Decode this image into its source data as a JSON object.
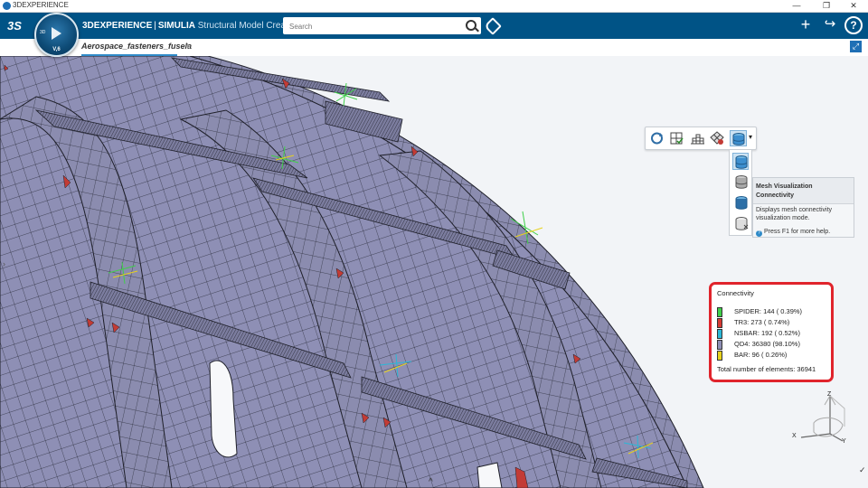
{
  "window": {
    "title": "3DEXPERIENCE",
    "minimize_glyph": "—",
    "restore_glyph": "❐",
    "close_glyph": "✕"
  },
  "topbar": {
    "logo_glyph": "3S",
    "brand_bold": "3DEXPERIENCE",
    "separator": "|",
    "brand_product": "SIMULIA",
    "app_name": "Structural Model Creation",
    "compass_version": "V,6",
    "compass_3d": "3D",
    "search_placeholder": "Search",
    "add_glyph": "+",
    "share_glyph": "↪",
    "help_glyph": "?"
  },
  "tabs": {
    "active_label": "Aerospace_fasteners_fusela",
    "add_glyph": "+",
    "maximize_glyph": "⤢"
  },
  "viewport": {
    "left_arrow_glyph": "›",
    "bottom_arrow_glyph": "^",
    "cursor_glyph": "✓"
  },
  "toolbar": {
    "icons": [
      "refresh-mesh-icon",
      "mesh-check-icon",
      "mesh-grid-icon",
      "mesh-quality-icon",
      "mesh-visualization-icon"
    ],
    "dropdown_glyph": "▾"
  },
  "tooltip": {
    "title": "Mesh Visualization Connectivity",
    "description": "Displays mesh connectivity visualization mode.",
    "help": "Press F1 for more help."
  },
  "legend": {
    "title": "Connectivity",
    "entries": [
      {
        "label": "SPIDER: 144 ( 0.39%)",
        "color": "#3fcf4a"
      },
      {
        "label": "TR3: 273 ( 0.74%)",
        "color": "#d63a32"
      },
      {
        "label": "NSBAR: 192 ( 0.52%)",
        "color": "#2bb7d6"
      },
      {
        "label": "QD4: 36380 (98.10%)",
        "color": "#8e8fb5"
      },
      {
        "label": "BAR: 96 ( 0.26%)",
        "color": "#e8d21c"
      }
    ],
    "total": "Total number of elements: 36941"
  },
  "triad": {
    "z": "Z",
    "x": "X",
    "y": "Y"
  },
  "colors": {
    "topbar": "#005386",
    "mesh": "#8e8fb5",
    "mesh_line": "#2a2c3a",
    "legend_border": "#e0242c"
  }
}
